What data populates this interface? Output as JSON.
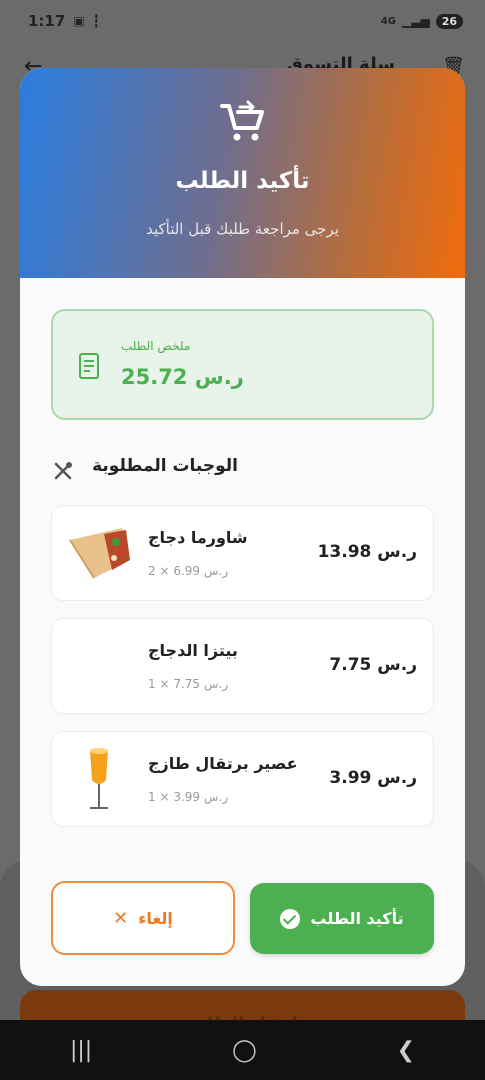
{
  "status_bar": {
    "time": "1:17",
    "network": "4G",
    "battery": "26"
  },
  "background": {
    "title": "سلة التسوق",
    "bottom_button": "إنشاء الطلب"
  },
  "dialog": {
    "title": "تأكيد الطلب",
    "subtitle": "يرجى مراجعة طلبك قبل التأكيد",
    "summary": {
      "label": "ملخص الطلب",
      "total": "25.72 ر.س"
    },
    "section_title": "الوجبات المطلوبة",
    "items": [
      {
        "name": "شاورما دجاج",
        "qty_line": "2 × 6.99 ر.س",
        "price": "13.98 ر.س"
      },
      {
        "name": "بيتزا الدجاج",
        "qty_line": "1 × 7.75 ر.س",
        "price": "7.75 ر.س"
      },
      {
        "name": "عصير برتقال طازج",
        "qty_line": "1 × 3.99 ر.س",
        "price": "3.99 ر.س"
      }
    ],
    "confirm_label": "تأكيد الطلب",
    "cancel_label": "إلغاء"
  },
  "icons": {
    "header": "cart-arrow-icon",
    "summary": "receipt-icon",
    "section": "utensils-icon",
    "cancel": "close-icon",
    "confirm": "check-circle-icon"
  },
  "colors": {
    "accent_green": "#4caf50",
    "accent_orange": "#f0791d",
    "gradient_start": "#2a7de0",
    "gradient_end": "#f26b0c"
  }
}
